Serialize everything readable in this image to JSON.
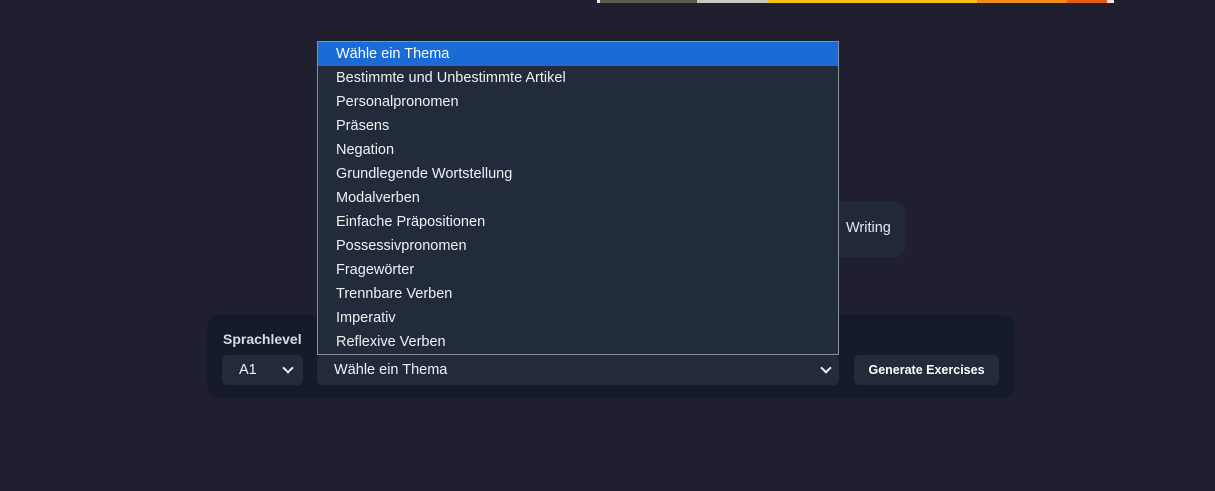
{
  "writing_card": {
    "label": "Writing"
  },
  "form": {
    "level_label": "Sprachlevel",
    "level_value": "A1",
    "topic_value": "Wähle ein Thema",
    "generate_label": "Generate Exercises"
  },
  "dropdown": {
    "options": [
      "Wähle ein Thema",
      "Bestimmte und Unbestimmte Artikel",
      "Personalpronomen",
      "Präsens",
      "Negation",
      "Grundlegende Wortstellung",
      "Modalverben",
      "Einfache Präpositionen",
      "Possessivpronomen",
      "Fragewörter",
      "Trennbare Verben",
      "Imperativ",
      "Reflexive Verben"
    ],
    "selected_index": 0
  },
  "colors": {
    "background": "#201f2f",
    "panel": "#151b29",
    "control": "#232b3b",
    "highlight": "#1a6bd6"
  },
  "icons": {
    "select_arrow": "chevron-down-icon"
  }
}
